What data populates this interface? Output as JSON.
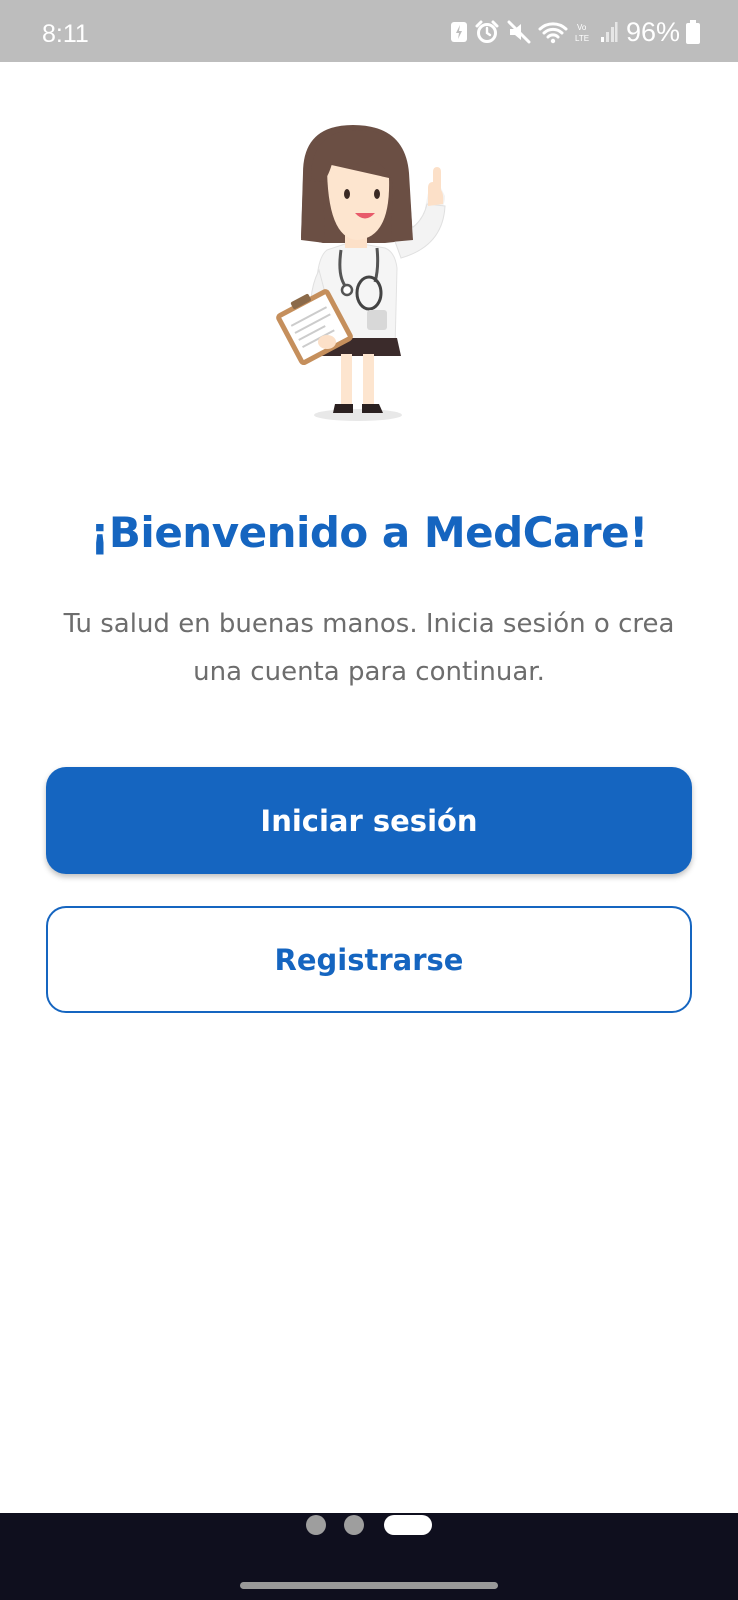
{
  "status_bar": {
    "time": "8:11",
    "battery_percent": "96%",
    "icons": [
      "data-saver-icon",
      "alarm-icon",
      "mute-icon",
      "wifi-icon",
      "volte-icon",
      "signal-icon",
      "battery-icon"
    ]
  },
  "welcome": {
    "title": "¡Bienvenido a MedCare!",
    "subtitle": "Tu salud en buenas manos. Inicia sesión o crea una cuenta para continuar."
  },
  "actions": {
    "login_label": "Iniciar sesión",
    "register_label": "Registrarse"
  },
  "pager": {
    "count": 3,
    "active_index": 2
  },
  "colors": {
    "primary": "#1565c0",
    "subtitle": "#6d6d6d",
    "status_bar_bg": "#bdbdbd",
    "nav_bar_bg": "#0f0f1e"
  }
}
